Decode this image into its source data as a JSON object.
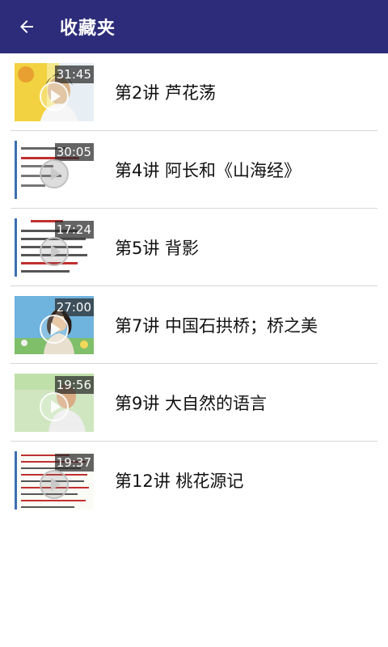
{
  "header": {
    "title": "收藏夹",
    "back_icon": "arrow-left-icon",
    "background": "#2c2c7a"
  },
  "favorites": [
    {
      "title": "第2讲 芦花荡",
      "duration": "31:45",
      "thumb_style": "portrait-yellow"
    },
    {
      "title": "第4讲 阿长和《山海经》",
      "duration": "30:05",
      "thumb_style": "slide-text"
    },
    {
      "title": "第5讲 背影",
      "duration": "17:24",
      "thumb_style": "slide-text-red"
    },
    {
      "title": "第7讲 中国石拱桥；桥之美",
      "duration": "27:00",
      "thumb_style": "portrait-sky"
    },
    {
      "title": "第9讲 大自然的语言",
      "duration": "19:56",
      "thumb_style": "portrait-green"
    },
    {
      "title": "第12讲 桃花源记",
      "duration": "19:37",
      "thumb_style": "slide-text-dense"
    }
  ]
}
